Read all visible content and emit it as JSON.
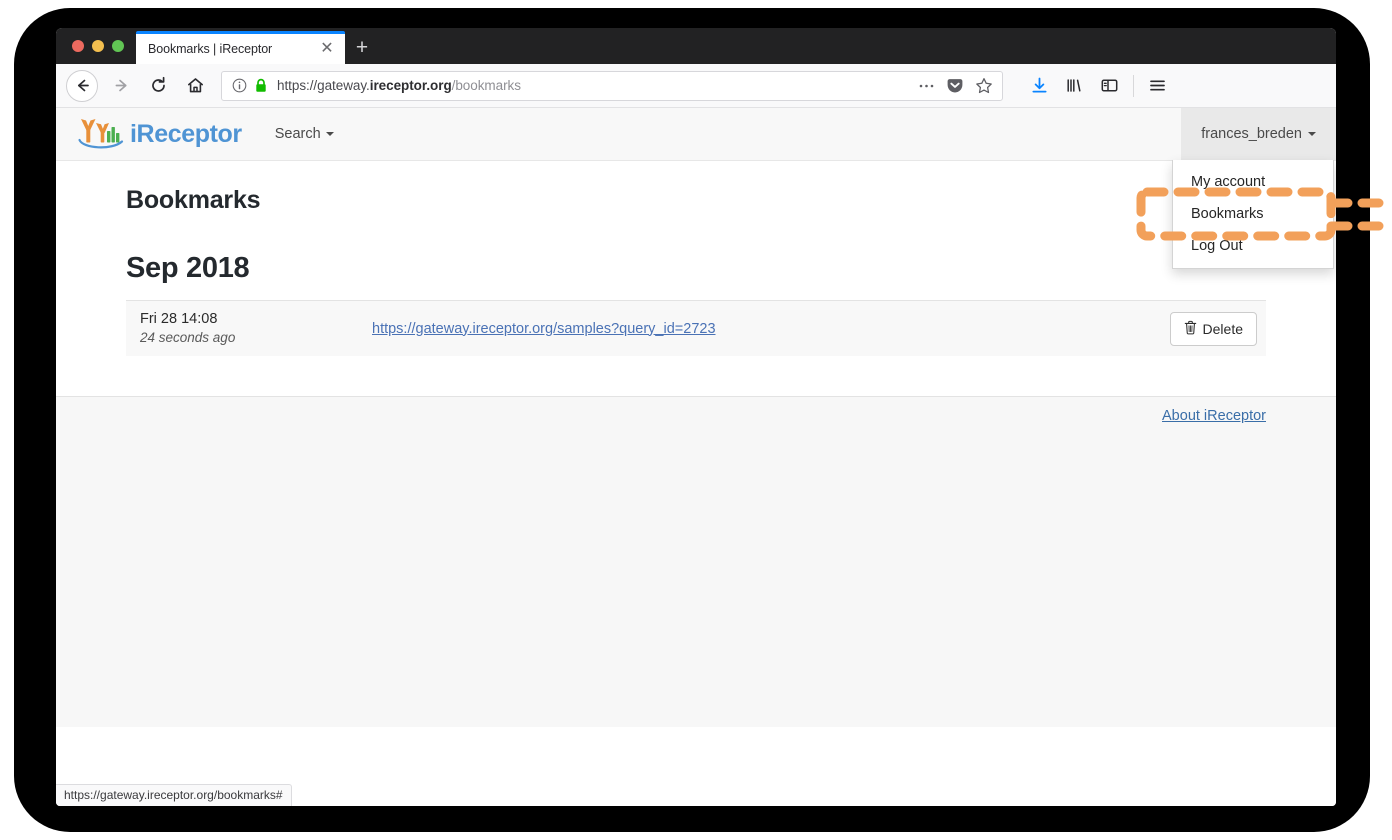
{
  "browser": {
    "tab": {
      "title": "Bookmarks | iReceptor",
      "close_label": "✕",
      "new_tab_label": "+"
    },
    "toolbar": {
      "back_icon": "back-arrow-icon",
      "forward_icon": "forward-arrow-icon",
      "reload_icon": "reload-icon",
      "home_icon": "home-icon",
      "url_prefix": "https://gateway.",
      "url_host": "ireceptor.org",
      "url_path": "/bookmarks",
      "url_full": "https://gateway.ireceptor.org/bookmarks",
      "page_actions_icon": "ellipsis-icon",
      "pocket_icon": "pocket-icon",
      "bookmark_star_icon": "star-icon",
      "downloads_icon": "download-icon",
      "library_icon": "library-icon",
      "sidebar_icon": "sidebar-icon",
      "app_menu_icon": "hamburger-menu-icon"
    },
    "status_bar": {
      "url": "https://gateway.ireceptor.org/bookmarks#"
    }
  },
  "site": {
    "brand": {
      "name": "iReceptor",
      "logo_icon": "ireceptor-logo-icon",
      "color": "#4f94d4"
    },
    "nav": {
      "search_label": "Search",
      "user_label": "frances_breden"
    },
    "user_menu": {
      "items": [
        {
          "label": "My account"
        },
        {
          "label": "Bookmarks"
        },
        {
          "label": "Log Out"
        }
      ]
    },
    "main": {
      "page_title": "Bookmarks",
      "month_heading": "Sep 2018",
      "bookmarks": [
        {
          "date": "Fri 28 14:08",
          "relative": "24 seconds ago",
          "url": "https://gateway.ireceptor.org/samples?query_id=2723",
          "delete_label": "Delete",
          "delete_icon": "trash-icon"
        }
      ]
    },
    "footer": {
      "about_label": "About iReceptor"
    }
  },
  "annotation": {
    "color": "#f2a05a",
    "highlight_target": "Bookmarks"
  }
}
